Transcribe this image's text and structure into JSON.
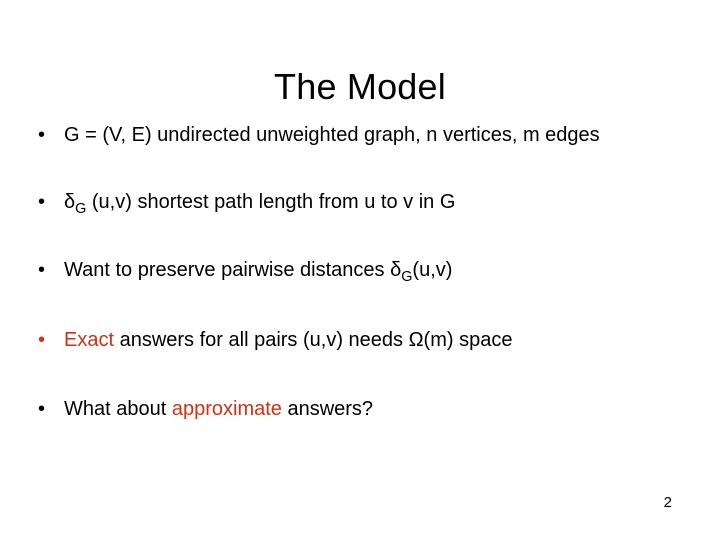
{
  "slide": {
    "title": "The Model",
    "page_number": "2",
    "accent_color": "#cc3311",
    "text_color": "#000000",
    "background_color": "#ffffff",
    "bullet_glyph": "•",
    "bullets": [
      {
        "marker": "•",
        "marker_color": "#000000",
        "segments": [
          {
            "text": "G = (V, E) undirected unweighted graph, n vertices, m edges",
            "style": "plain"
          }
        ]
      },
      {
        "marker": "•",
        "marker_color": "#000000",
        "segments": [
          {
            "text": "δ",
            "style": "plain"
          },
          {
            "text": "G",
            "style": "subscript"
          },
          {
            "text": " (u,v) shortest path length from u to v in G",
            "style": "plain"
          }
        ]
      },
      {
        "marker": "•",
        "marker_color": "#000000",
        "segments": [
          {
            "text": "Want to preserve pairwise distances ",
            "style": "plain"
          },
          {
            "text": "δ",
            "style": "plain"
          },
          {
            "text": "G",
            "style": "subscript"
          },
          {
            "text": "(u,v)",
            "style": "plain"
          }
        ]
      },
      {
        "marker": "•",
        "marker_color": "#cc3311",
        "segments": [
          {
            "text": "Exact",
            "style": "highlight"
          },
          {
            "text": " answers for all pairs (u,v) needs Ω(m) space",
            "style": "plain"
          }
        ]
      },
      {
        "marker": "•",
        "marker_color": "#000000",
        "segments": [
          {
            "text": "What about ",
            "style": "plain"
          },
          {
            "text": "approximate",
            "style": "highlight"
          },
          {
            "text": " answers?",
            "style": "plain"
          }
        ]
      }
    ]
  }
}
